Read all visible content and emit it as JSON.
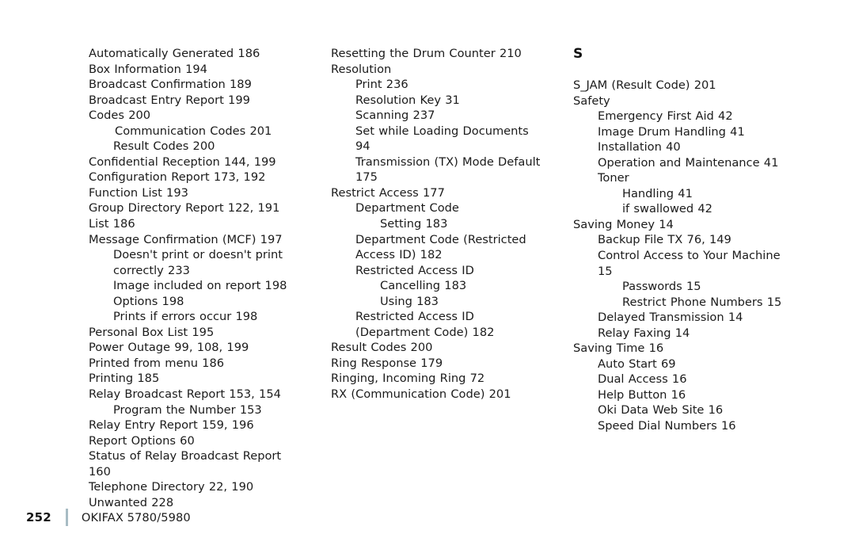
{
  "footer": {
    "page_number": "252",
    "manual_title": "OKIFAX 5780/5980",
    "rule_color": "#a8bcc4"
  },
  "columns": [
    {
      "heading": "",
      "entries": [
        {
          "text": "Automatically Generated  186",
          "level": 0
        },
        {
          "text": "Box Information  194",
          "level": 0
        },
        {
          "text": "Broadcast Confirmation  189",
          "level": 0
        },
        {
          "text": "Broadcast Entry Report  199",
          "level": 0
        },
        {
          "text": "Codes  200",
          "level": 0
        },
        {
          "text": "Communication Codes  201",
          "level": 1
        },
        {
          "text": "Result Codes  200",
          "level": 1
        },
        {
          "text": "Confidential Reception  144, 199",
          "level": 0
        },
        {
          "text": "Configuration Report  173, 192",
          "level": 0
        },
        {
          "text": "Function List  193",
          "level": 0
        },
        {
          "text": "Group Directory Report  122, 191",
          "level": 0
        },
        {
          "text": "List  186",
          "level": 0
        },
        {
          "text": "Message Confirmation (MCF)  197",
          "level": 0
        },
        {
          "text": "Doesn't print or doesn't print correctly  233",
          "level": 1
        },
        {
          "text": "Image included on report  198",
          "level": 1
        },
        {
          "text": "Options  198",
          "level": 1
        },
        {
          "text": "Prints if errors occur  198",
          "level": 1
        },
        {
          "text": "Personal Box List  195",
          "level": 0
        },
        {
          "text": "Power Outage  99, 108, 199",
          "level": 0
        },
        {
          "text": "Printed from menu  186",
          "level": 0
        },
        {
          "text": "Printing  185",
          "level": 0
        },
        {
          "text": "Relay Broadcast Report  153, 154",
          "level": 0
        },
        {
          "text": "Program the Number  153",
          "level": 1
        },
        {
          "text": "Relay Entry Report  159, 196",
          "level": 0
        },
        {
          "text": "Report Options  60",
          "level": 0
        },
        {
          "text": "Status of Relay Broadcast Report  160",
          "level": 0
        },
        {
          "text": "Telephone Directory  22, 190",
          "level": 0
        },
        {
          "text": "Unwanted  228",
          "level": 0
        }
      ]
    },
    {
      "heading": "",
      "entries": [
        {
          "text": "Resetting the Drum Counter  210",
          "level": 0
        },
        {
          "text": "Resolution",
          "level": 0
        },
        {
          "text": "Print  236",
          "level": 1
        },
        {
          "text": "Resolution Key  31",
          "level": 1
        },
        {
          "text": "Scanning  237",
          "level": 1
        },
        {
          "text": "Set while Loading Documents  94",
          "level": 1
        },
        {
          "text": "Transmission (TX) Mode Default  175",
          "level": 1
        },
        {
          "text": "Restrict Access  177",
          "level": 0
        },
        {
          "text": "Department Code",
          "level": 1
        },
        {
          "text": "Setting  183",
          "level": 2
        },
        {
          "text": "Department Code (Restricted Access ID)  182",
          "level": 1
        },
        {
          "text": "Restricted Access ID",
          "level": 1
        },
        {
          "text": "Cancelling  183",
          "level": 2
        },
        {
          "text": "Using  183",
          "level": 2
        },
        {
          "text": "Restricted Access ID (Department Code)  182",
          "level": 1
        },
        {
          "text": "Result Codes  200",
          "level": 0
        },
        {
          "text": "Ring Response  179",
          "level": 0
        },
        {
          "text": "Ringing, Incoming Ring  72",
          "level": 0
        },
        {
          "text": "RX  (Communication Code)  201",
          "level": 0
        }
      ]
    },
    {
      "heading": "S",
      "entries": [
        {
          "text": "S_JAM (Result Code)  201",
          "level": 0
        },
        {
          "text": "Safety",
          "level": 0
        },
        {
          "text": "Emergency First Aid  42",
          "level": 1
        },
        {
          "text": "Image Drum Handling  41",
          "level": 1
        },
        {
          "text": "Installation  40",
          "level": 1
        },
        {
          "text": "Operation and Maintenance  41",
          "level": 1
        },
        {
          "text": "Toner",
          "level": 1
        },
        {
          "text": "Handling  41",
          "level": 2
        },
        {
          "text": "if swallowed  42",
          "level": 2
        },
        {
          "text": "Saving Money  14",
          "level": 0
        },
        {
          "text": "Backup File TX  76, 149",
          "level": 1
        },
        {
          "text": "Control Access to Your Machine  15",
          "level": 1
        },
        {
          "text": "Passwords  15",
          "level": 2
        },
        {
          "text": "Restrict Phone Numbers  15",
          "level": 2
        },
        {
          "text": "Delayed Transmission  14",
          "level": 1
        },
        {
          "text": "Relay Faxing  14",
          "level": 1
        },
        {
          "text": "Saving Time  16",
          "level": 0
        },
        {
          "text": "Auto Start  69",
          "level": 1
        },
        {
          "text": "Dual Access  16",
          "level": 1
        },
        {
          "text": "Help Button  16",
          "level": 1
        },
        {
          "text": "Oki Data Web Site  16",
          "level": 1
        },
        {
          "text": "Speed Dial Numbers  16",
          "level": 1
        }
      ]
    }
  ]
}
